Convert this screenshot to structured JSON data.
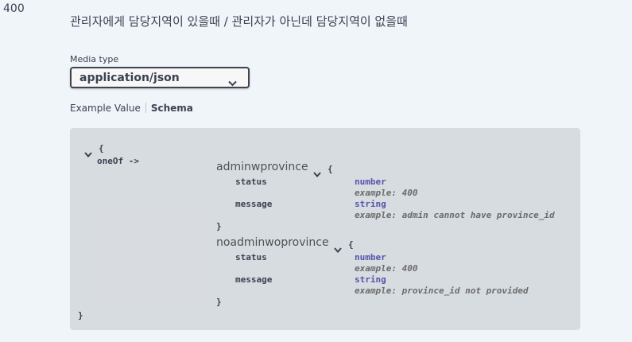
{
  "response": {
    "status_code": "400",
    "description": "관리자에게 담당지역이 있을때 / 관리자가 아닌데 담당지역이 없을때"
  },
  "media": {
    "label": "Media type",
    "selected": "application/json"
  },
  "tabs": {
    "example_value": "Example Value",
    "schema": "Schema",
    "active": "Schema"
  },
  "schema": {
    "open_brace": "{",
    "close_brace": "}",
    "oneof_label": "oneOf ->",
    "models": [
      {
        "title": "adminwprovince",
        "open_brace": "{",
        "close_brace": "}",
        "properties": [
          {
            "name": "status",
            "type": "number",
            "example": "example: 400"
          },
          {
            "name": "message",
            "type": "string",
            "example": "example: admin cannot have province_id"
          }
        ]
      },
      {
        "title": "noadminwoprovince",
        "open_brace": "{",
        "close_brace": "}",
        "properties": [
          {
            "name": "status",
            "type": "number",
            "example": "example: 400"
          },
          {
            "name": "message",
            "type": "string",
            "example": "example: province_id not provided"
          }
        ]
      }
    ]
  },
  "icons": {
    "select_chevron": "chevron-down-icon",
    "expand_toggle": "chevron-down-icon"
  },
  "colors": {
    "background": "#f0f5fa",
    "schema_box": "#d7dde4",
    "type_text": "#55aa",
    "example_text": "#6b6b6b"
  }
}
